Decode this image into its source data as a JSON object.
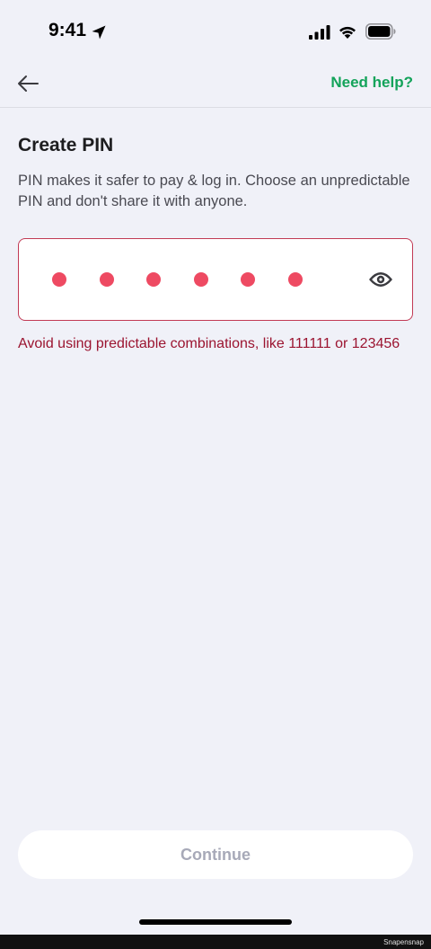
{
  "status_bar": {
    "time": "9:41",
    "icons": [
      "location-arrow-icon",
      "cellular-signal-icon",
      "wifi-icon",
      "battery-icon"
    ]
  },
  "nav": {
    "back_icon": "arrow-left-icon",
    "help_label": "Need help?"
  },
  "content": {
    "title": "Create PIN",
    "description": "PIN makes it safer to pay & log in. Choose an unpredictable PIN and don't share it with anyone.",
    "pin": {
      "entered_digits": 6,
      "visibility_icon": "eye-icon"
    },
    "error": "Avoid using predictable combinations, like 111111 or 123456"
  },
  "footer": {
    "continue_label": "Continue"
  },
  "watermark": "Snapensnap",
  "colors": {
    "background": "#f0f1f8",
    "accent_green": "#13a35a",
    "error_red": "#9b1430",
    "pin_dot": "#ee4a62",
    "field_border": "#c23a55",
    "disabled_text": "#a7a9b8"
  }
}
